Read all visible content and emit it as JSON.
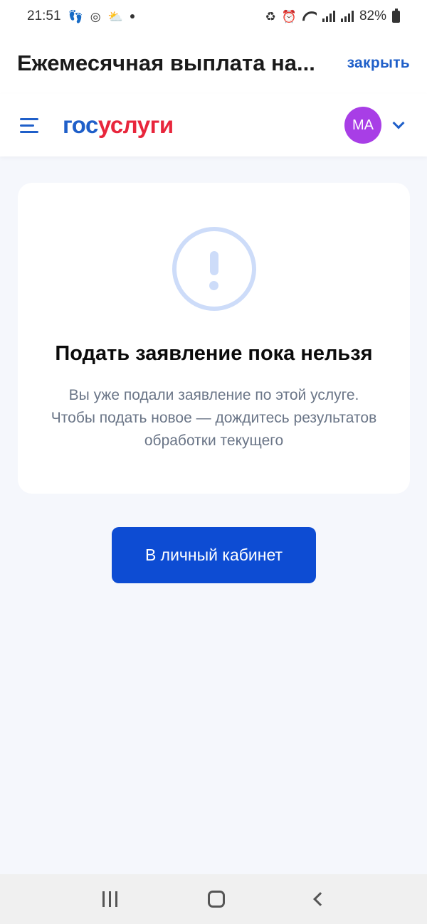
{
  "status_bar": {
    "time": "21:51",
    "battery": "82%",
    "icons": [
      "footsteps-icon",
      "instagram-icon",
      "weather-icon",
      "dot-icon",
      "battery-saver-icon",
      "alarm-icon",
      "wifi-icon",
      "signal-icon",
      "signal-icon",
      "battery-icon"
    ]
  },
  "title_bar": {
    "title": "Ежемесячная выплата на...",
    "close_label": "закрыть"
  },
  "header": {
    "logo_part1": "гос",
    "logo_part2": "услуги",
    "avatar_initials": "МА"
  },
  "card": {
    "icon": "exclamation-circle-icon",
    "title": "Подать заявление пока нельзя",
    "text": "Вы уже подали заявление по этой услуге. Чтобы подать новое — дождитесь результатов обработки текущего"
  },
  "primary_button": {
    "label": "В личный кабинет"
  },
  "colors": {
    "brand_blue": "#0d4cd3",
    "link_blue": "#1f5fc9",
    "brand_red": "#e8263c",
    "avatar_purple": "#a83ee6",
    "background": "#f5f7fc"
  }
}
